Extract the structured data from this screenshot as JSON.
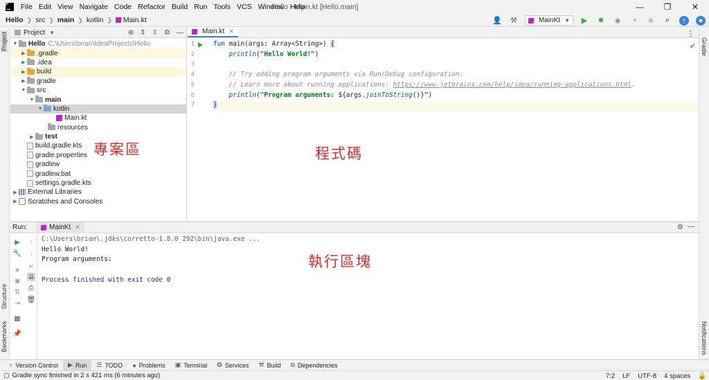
{
  "window": {
    "title": "Hello - Main.kt [Hello.main]",
    "menu": [
      "File",
      "Edit",
      "View",
      "Navigate",
      "Code",
      "Refactor",
      "Build",
      "Run",
      "Tools",
      "VCS",
      "Window",
      "Help"
    ],
    "controls": {
      "minimize": "—",
      "maximize": "❐",
      "close": "✕"
    }
  },
  "navbar": {
    "breadcrumbs": [
      "Hello",
      "src",
      "main",
      "kotlin",
      "Main.kt"
    ],
    "run_config": "MainKt"
  },
  "left_stripe": {
    "project": "Project",
    "structure": "Structure",
    "bookmarks": "Bookmarks"
  },
  "right_stripe": {
    "gradle": "Gradle",
    "notifications": "Notifications"
  },
  "project_panel": {
    "title": "Project",
    "tree": [
      {
        "label": "Hello",
        "path": "C:\\Users\\brian\\IdeaProjects\\Hello"
      },
      {
        "label": ".gradle"
      },
      {
        "label": ".idea"
      },
      {
        "label": "build"
      },
      {
        "label": "gradle"
      },
      {
        "label": "src"
      },
      {
        "label": "main"
      },
      {
        "label": "kotlin"
      },
      {
        "label": "Main.kt"
      },
      {
        "label": "resources"
      },
      {
        "label": "test"
      },
      {
        "label": "build.gradle.kts"
      },
      {
        "label": "gradle.properties"
      },
      {
        "label": "gradlew"
      },
      {
        "label": "gradlew.bat"
      },
      {
        "label": "settings.gradle.kts"
      },
      {
        "label": "External Libraries"
      },
      {
        "label": "Scratches and Consoles"
      }
    ]
  },
  "editor": {
    "tab": "Main.kt",
    "line_numbers": [
      "1",
      "2",
      "3",
      "4",
      "5",
      "6",
      "7"
    ],
    "code": {
      "l1_kw": "fun",
      "l1_rest": " main(args: Array<String>) ",
      "l1_brace": "{",
      "l2_fn": "println",
      "l2_open": "(",
      "l2_str": "\"Hello World!\"",
      "l2_close": ")",
      "l4_cmt": "// Try adding program arguments via Run/Debug configuration.",
      "l5_cmt": "// Learn more about running applications: ",
      "l5_link": "https://www.jetbrains.com/help/idea/running-applications.html",
      "l5_dot": ".",
      "l6_fn": "println",
      "l6_open": "(",
      "l6_str1": "\"Program arguments: ",
      "l6_interp": "${args.",
      "l6_call": "joinToString",
      "l6_interp2": "()}",
      "l6_str2": "\"",
      "l6_close": ")",
      "l7_brace": "}"
    }
  },
  "run_panel": {
    "label": "Run:",
    "tab": "MainKt",
    "output": [
      "C:\\Users\\brian\\.jdks\\corretto-1.8.0_292\\bin\\java.exe ...",
      "Hello World!",
      "Program arguments: ",
      "",
      "Process finished with exit code 0"
    ]
  },
  "bottom_tabs": [
    "Version Control",
    "Run",
    "TODO",
    "Problems",
    "Terminal",
    "Services",
    "Build",
    "Dependencies"
  ],
  "status": {
    "message": "Gradle sync finished in 2 s 421 ms (6 minutes ago)",
    "position": "7:2",
    "line_sep": "LF",
    "encoding": "UTF-8",
    "indent": "4 spaces"
  },
  "annotations": {
    "project_area": "專案區",
    "code_area": "程式碼",
    "run_area": "執行區塊"
  },
  "colors": {
    "keyword": "#0033b3",
    "string": "#067d17",
    "comment": "#8c8c8c",
    "annotation": "#d32f2f",
    "run_green": "#3fa63f"
  }
}
